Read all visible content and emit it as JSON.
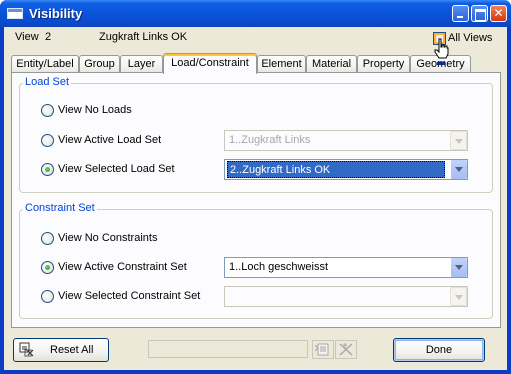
{
  "window": {
    "title": "Visibility"
  },
  "header": {
    "view_label": "View",
    "view_number": "2",
    "view_name": "Zugkraft Links OK",
    "all_views_label": "All Views",
    "all_views_checked": false
  },
  "tabs": [
    {
      "label": "Entity/Label",
      "active": false
    },
    {
      "label": "Group",
      "active": false
    },
    {
      "label": "Layer",
      "active": false
    },
    {
      "label": "Load/Constraint",
      "active": true
    },
    {
      "label": "Element",
      "active": false
    },
    {
      "label": "Material",
      "active": false
    },
    {
      "label": "Property",
      "active": false
    },
    {
      "label": "Geometry",
      "active": false
    }
  ],
  "load_set": {
    "title": "Load Set",
    "options": [
      {
        "label": "View No Loads",
        "checked": false
      },
      {
        "label": "View Active Load Set",
        "checked": false
      },
      {
        "label": "View Selected Load Set",
        "checked": true
      }
    ],
    "active_combo": {
      "value": "1..Zugkraft Links",
      "enabled": false
    },
    "selected_combo": {
      "value": "2..Zugkraft Links OK",
      "enabled": true
    }
  },
  "constraint_set": {
    "title": "Constraint Set",
    "options": [
      {
        "label": "View No Constraints",
        "checked": false
      },
      {
        "label": "View Active Constraint Set",
        "checked": true
      },
      {
        "label": "View Selected Constraint Set",
        "checked": false
      }
    ],
    "active_combo": {
      "value": "1..Loch geschweisst",
      "enabled": true
    },
    "selected_combo": {
      "value": "",
      "enabled": false
    }
  },
  "footer": {
    "reset_label": "Reset All",
    "done_label": "Done"
  },
  "icons": {
    "app": "window-icon",
    "reset": "reset-all-icon",
    "cursor": "hand-pointer-icon",
    "tool1": "list-tool-icon",
    "tool2": "pick-tool-icon"
  },
  "colors": {
    "title_bar": "#0a52d8",
    "group_title": "#0046d5",
    "selection": "#316ac5",
    "radio_check": "#21a121",
    "tab_highlight": "#ffc83c"
  }
}
